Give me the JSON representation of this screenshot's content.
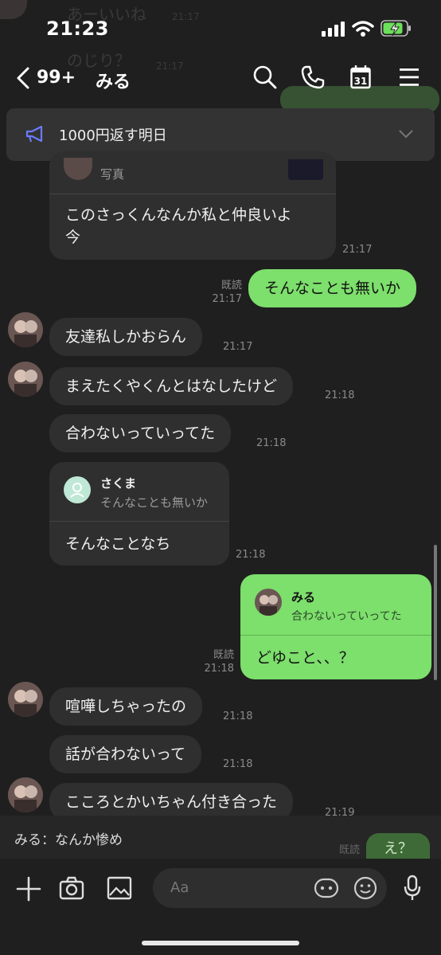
{
  "status_bar": {
    "time": "21:23"
  },
  "background_ghost": {
    "line1": "あーいいね",
    "line2": "のじり？",
    "time1": "21:17",
    "time2": "21:17"
  },
  "header": {
    "back_count": "99+",
    "chat_name": "みる",
    "calendar_day": "31"
  },
  "announcement": {
    "text": "1000円返す明日"
  },
  "messages": {
    "m1": {
      "reply_sub": "写真",
      "text_line1": "このさっくんなんか私と仲良いよ",
      "text_line2": "今",
      "time": "21:17"
    },
    "m2": {
      "read": "既読",
      "time": "21:17",
      "text": "そんなことも無いか"
    },
    "m3": {
      "text": "友達私しかおらん",
      "time": "21:17"
    },
    "m4": {
      "text": "まえたくやくんとはなしたけど",
      "time": "21:18"
    },
    "m5": {
      "text": "合わないっていってた",
      "time": "21:18"
    },
    "m6": {
      "reply_name": "さくま",
      "reply_text": "そんなことも無いか",
      "text": "そんなことなち",
      "time": "21:18"
    },
    "m7": {
      "reply_name": "みる",
      "reply_text": "合わないっていってた",
      "text": "どゆこと、、？",
      "read": "既読",
      "time": "21:18"
    },
    "m8": {
      "text": "喧嘩しちゃったの",
      "time": "21:18"
    },
    "m9": {
      "text": "話が合わないって",
      "time": "21:18"
    },
    "m10": {
      "text": "こころとかいちゃん付き合った",
      "time": "21:19"
    }
  },
  "preview": {
    "text": "みる：なんか惨め",
    "read": "既読",
    "bubble": "え？"
  },
  "input": {
    "placeholder": "Aa"
  },
  "colors": {
    "green_bubble": "#7ddf6c",
    "dark_bubble": "#2f2f2f",
    "background": "#1f1f1f",
    "megaphone": "#6b7bff"
  }
}
